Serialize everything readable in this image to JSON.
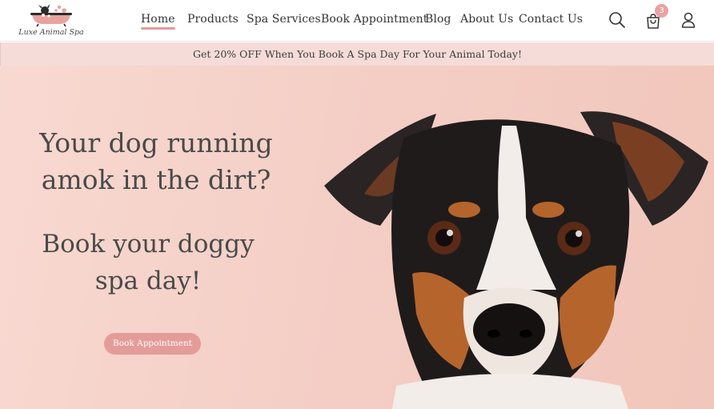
{
  "brand": {
    "name": "Luxe Animal Spa"
  },
  "nav": {
    "items": [
      {
        "id": "home",
        "label": "Home",
        "active": true
      },
      {
        "id": "products",
        "label": "Products"
      },
      {
        "id": "spa",
        "label": "Spa Services"
      },
      {
        "id": "book",
        "label": "Book Appointment"
      },
      {
        "id": "blog",
        "label": "Blog"
      },
      {
        "id": "about",
        "label": "About Us"
      },
      {
        "id": "contact",
        "label": "Contact Us"
      }
    ]
  },
  "header_icons": {
    "search": "search-icon",
    "cart": "shopping-bag-icon",
    "account": "user-icon"
  },
  "cart": {
    "count": "3"
  },
  "promo": {
    "text": "Get 20% OFF When You Book A Spa Day For Your Animal Today!"
  },
  "hero": {
    "title_line1": "Your dog running",
    "title_line2": "amok in the dirt?",
    "subtitle_line1": "Book your doggy",
    "subtitle_line2": "spa day!",
    "cta_label": "Book Appointment"
  },
  "colors": {
    "accent": "#e49c98",
    "promo_bg": "#f5dcd8",
    "hero_bg": "#f4cfc6",
    "badge": "#e8a3a0"
  }
}
